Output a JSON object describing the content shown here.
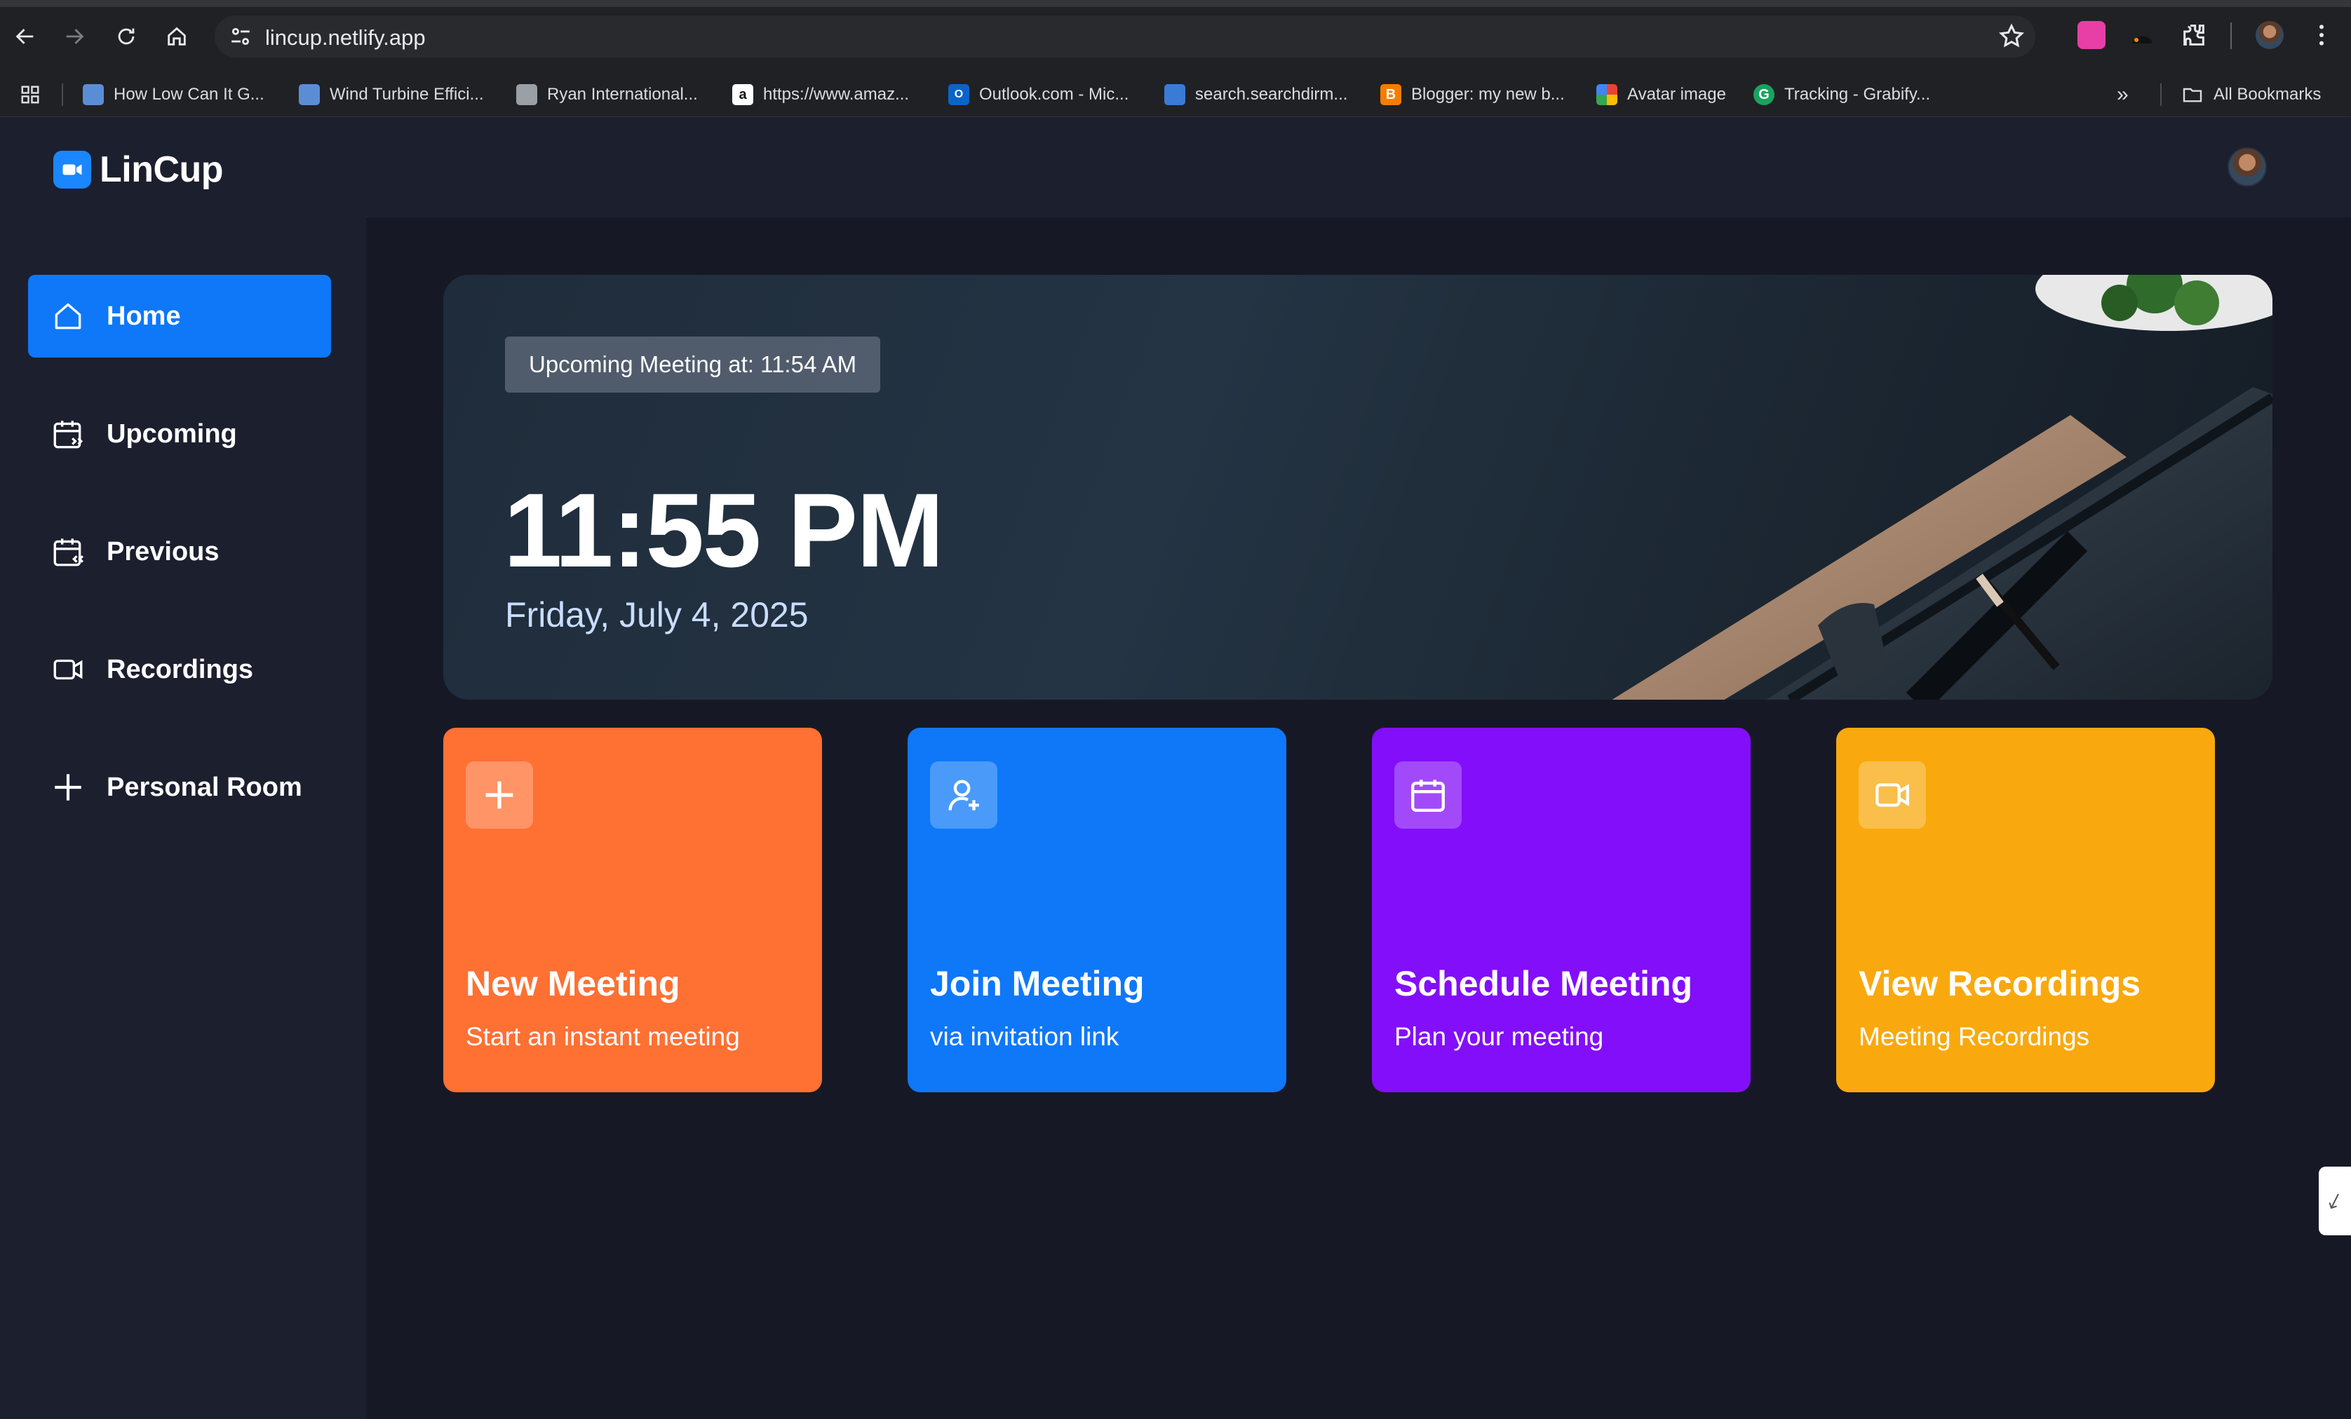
{
  "browser": {
    "url": "lincup.netlify.app",
    "bookmarks": [
      {
        "label": "How Low Can It G...",
        "icon": "page-icon",
        "color": "#5b8dd6"
      },
      {
        "label": "Wind Turbine Effici...",
        "icon": "page-icon",
        "color": "#5b8dd6"
      },
      {
        "label": "Ryan International...",
        "icon": "doc-icon",
        "color": "#9aa0a6"
      },
      {
        "label": "https://www.amaz...",
        "icon": "amazon-icon",
        "color": "#ffffff"
      },
      {
        "label": "Outlook.com - Mic...",
        "icon": "outlook-icon",
        "color": "#0a64c8"
      },
      {
        "label": "search.searchdirm...",
        "icon": "search-page-icon",
        "color": "#3a7bd5"
      },
      {
        "label": "Blogger: my new b...",
        "icon": "blogger-icon",
        "color": "#f57d00"
      },
      {
        "label": "Avatar image",
        "icon": "pinwheel-icon",
        "color": "#34a853"
      },
      {
        "label": "Tracking - Grabify...",
        "icon": "grabify-icon",
        "color": "#1aa260"
      }
    ],
    "all_bookmarks": "All Bookmarks"
  },
  "app": {
    "name": "LinCup",
    "accent": "#0e78f9"
  },
  "sidebar": {
    "items": [
      {
        "label": "Home",
        "icon": "home-icon",
        "active": true
      },
      {
        "label": "Upcoming",
        "icon": "calendar-forward-icon",
        "active": false
      },
      {
        "label": "Previous",
        "icon": "calendar-back-icon",
        "active": false
      },
      {
        "label": "Recordings",
        "icon": "video-icon",
        "active": false
      },
      {
        "label": "Personal Room",
        "icon": "plus-icon",
        "active": false
      }
    ]
  },
  "hero": {
    "upcoming": "Upcoming Meeting at: 11:54 AM",
    "time": "11:55 PM",
    "date": "Friday, July 4, 2025"
  },
  "cards": [
    {
      "title": "New Meeting",
      "subtitle": "Start an instant meeting",
      "icon": "plus-icon",
      "color": "#ff7033"
    },
    {
      "title": "Join Meeting",
      "subtitle": "via invitation link",
      "icon": "user-plus-icon",
      "color": "#0e78f9"
    },
    {
      "title": "Schedule Meeting",
      "subtitle": "Plan your meeting",
      "icon": "calendar-icon",
      "color": "#830ef9"
    },
    {
      "title": "View Recordings",
      "subtitle": "Meeting Recordings",
      "icon": "video-icon",
      "color": "#f9a90e"
    }
  ]
}
